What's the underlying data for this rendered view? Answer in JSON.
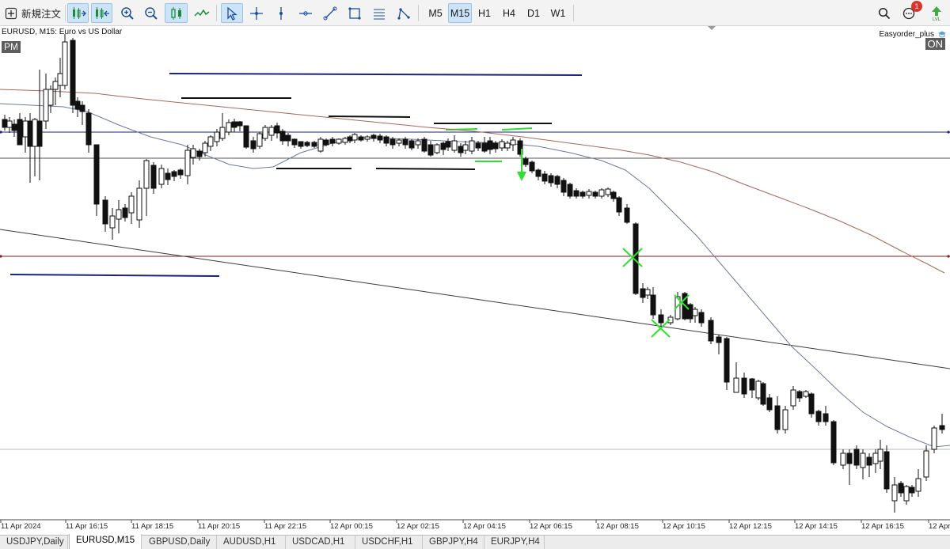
{
  "toolbar": {
    "new_order_label": "新規注文",
    "timeframes": [
      "M5",
      "M15",
      "H1",
      "H4",
      "D1",
      "W1"
    ],
    "active_timeframe": "M15",
    "notification_count": "1"
  },
  "chart": {
    "title": "EURUSD, M15:  Euro vs US Dollar",
    "session_tag": "PM",
    "indicator_label": "Easyorder_plus",
    "status_tag": "ON",
    "x_labels": [
      "11 Apr 2024",
      "11 Apr 16:15",
      "11 Apr 18:15",
      "11 Apr 20:15",
      "11 Apr 22:15",
      "12 Apr 00:15",
      "12 Apr 02:15",
      "12 Apr 04:15",
      "12 Apr 06:15",
      "12 Apr 08:15",
      "12 Apr 10:15",
      "12 Apr 12:15",
      "12 Apr 14:15",
      "12 Apr 16:15",
      "12 Apr"
    ]
  },
  "tabs": [
    "USDJPY,Daily",
    "EURUSD,M15",
    "GBPUSD,Daily",
    "AUDUSD,H1",
    "USDCAD,H1",
    "USDCHF,H1",
    "GBPJPY,H4",
    "EURJPY,H4"
  ],
  "active_tab": "EURUSD,M15",
  "colors": {
    "ma_fast": "#6c7a9c",
    "ma_slow": "#a8675a",
    "hline_red": "#8b1a1a",
    "hline_blue": "#1a237e",
    "signal_green": "#2fe02f",
    "toolbar_active": "#cde4f7"
  }
}
